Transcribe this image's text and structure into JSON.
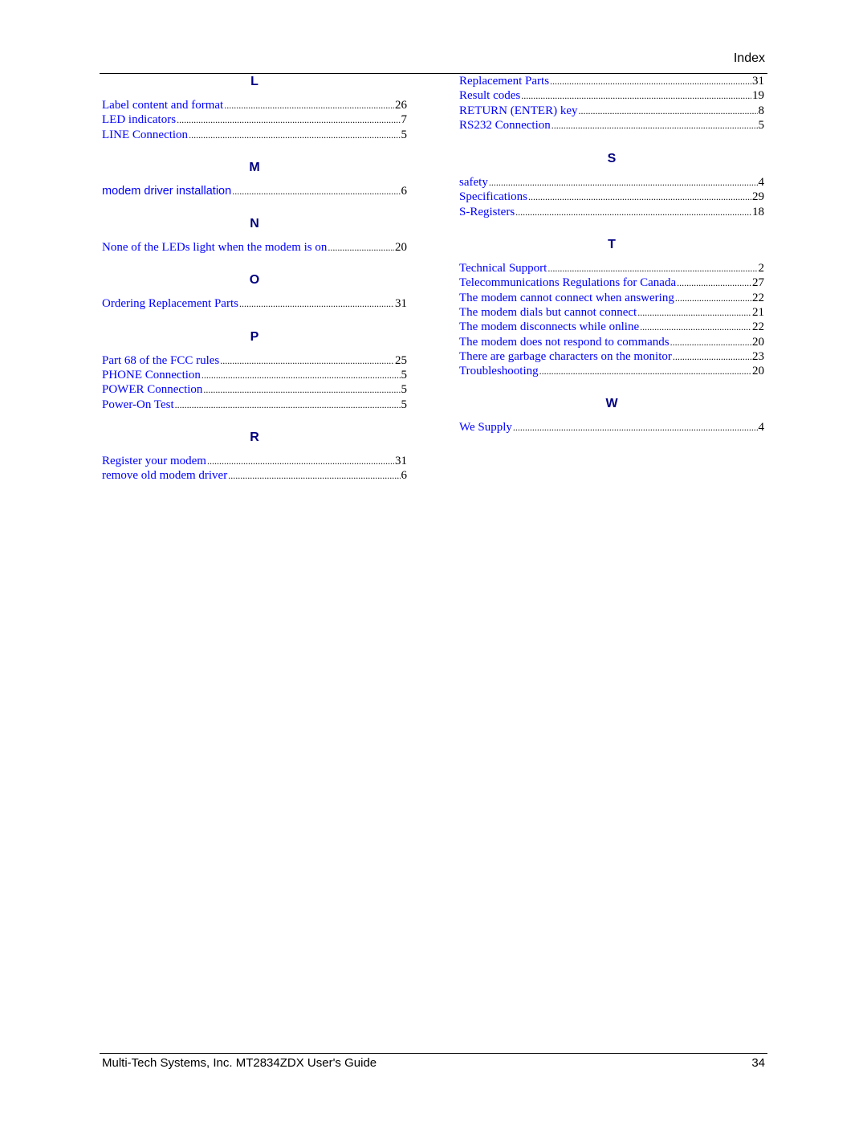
{
  "header": {
    "title": "Index"
  },
  "colors": {
    "link": "#0000ff",
    "letter": "#000080",
    "text": "#000000"
  },
  "left_column": [
    {
      "letter": "L",
      "entries": [
        {
          "label": "Label content and format",
          "page": "26"
        },
        {
          "label": "LED indicators",
          "page": "7"
        },
        {
          "label": "LINE Connection",
          "page": "5"
        }
      ]
    },
    {
      "letter": "M",
      "entries": [
        {
          "label": "modem driver installation",
          "page": "6"
        }
      ]
    },
    {
      "letter": "N",
      "entries": [
        {
          "label": "None of the LEDs light when the modem is on",
          "page": "20"
        }
      ]
    },
    {
      "letter": "O",
      "entries": [
        {
          "label": "Ordering Replacement Parts",
          "page": "31"
        }
      ]
    },
    {
      "letter": "P",
      "entries": [
        {
          "label": "Part 68 of the FCC rules",
          "page": "25"
        },
        {
          "label": "PHONE Connection",
          "page": "5"
        },
        {
          "label": "POWER Connection",
          "page": "5"
        },
        {
          "label": "Power-On Test",
          "page": "5"
        }
      ]
    },
    {
      "letter": "R",
      "entries": [
        {
          "label": "Register your modem",
          "page": "31"
        },
        {
          "label": "remove old modem driver",
          "page": "6"
        }
      ]
    }
  ],
  "right_column": {
    "continued_entries": [
      {
        "label": "Replacement Parts",
        "page": "31"
      },
      {
        "label": "Result codes",
        "page": "19"
      },
      {
        "label": "RETURN (ENTER) key",
        "page": "8"
      },
      {
        "label": "RS232 Connection",
        "page": "5"
      }
    ],
    "sections": [
      {
        "letter": "S",
        "entries": [
          {
            "label": "safety",
            "page": "4"
          },
          {
            "label": "Specifications",
            "page": "29"
          },
          {
            "label": "S-Registers",
            "page": "18"
          }
        ]
      },
      {
        "letter": "T",
        "entries": [
          {
            "label": "Technical Support",
            "page": "2"
          },
          {
            "label": "Telecommunications Regulations for Canada",
            "page": "27"
          },
          {
            "label": "The modem cannot connect when answering",
            "page": "22"
          },
          {
            "label": "The modem dials but cannot connect",
            "page": "21"
          },
          {
            "label": "The modem disconnects while online",
            "page": "22"
          },
          {
            "label": "The modem does not respond to commands",
            "page": "20"
          },
          {
            "label": "There are garbage characters on the monitor",
            "page": "23"
          },
          {
            "label": "Troubleshooting",
            "page": "20"
          }
        ]
      },
      {
        "letter": "W",
        "entries": [
          {
            "label": "We Supply",
            "page": "4"
          }
        ]
      }
    ]
  },
  "footer": {
    "left": "Multi-Tech Systems, Inc. MT2834ZDX User's Guide",
    "page_number": "34"
  }
}
